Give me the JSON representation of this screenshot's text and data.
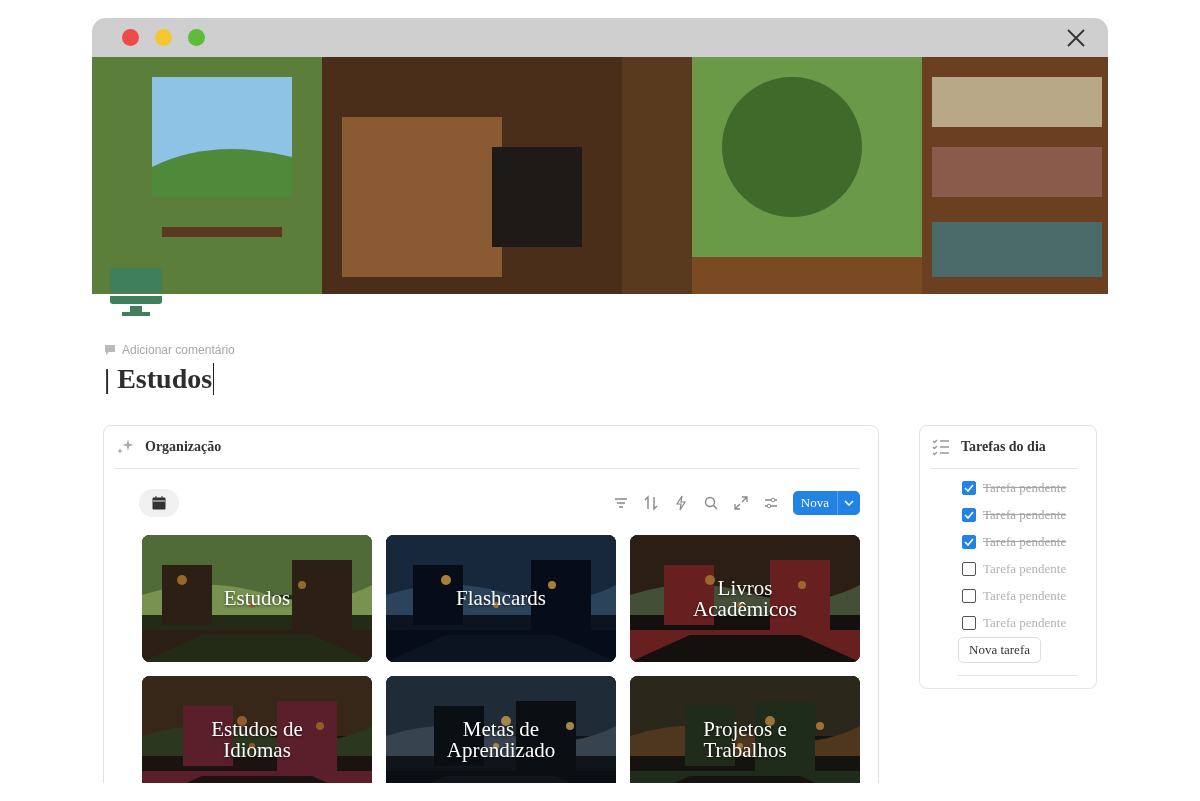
{
  "page": {
    "comment_hint": "Adicionar comentário",
    "title": "| Estudos"
  },
  "gallery": {
    "title": "Organização",
    "new_button": "Nova",
    "cards": [
      {
        "title": "Estudos",
        "kind": "picture"
      },
      {
        "title": "Flashcards",
        "kind": "picture"
      },
      {
        "title": "Livros Acadêmicos",
        "kind": "picture"
      },
      {
        "title": "Estudos de Idiomas",
        "kind": "picture"
      },
      {
        "title": "Metas de Aprendizado",
        "kind": "picture"
      },
      {
        "title": "Projetos e Trabalhos",
        "kind": "picture"
      }
    ]
  },
  "tasks": {
    "title": "Tarefas do dia",
    "new_button": "Nova tarefa",
    "items": [
      {
        "label": "Tarefa pendente",
        "checked": true
      },
      {
        "label": "Tarefa pendente",
        "checked": true
      },
      {
        "label": "Tarefa pendente",
        "checked": true
      },
      {
        "label": "Tarefa pendente",
        "checked": false
      },
      {
        "label": "Tarefa pendente",
        "checked": false
      },
      {
        "label": "Tarefa pendente",
        "checked": false
      }
    ]
  }
}
